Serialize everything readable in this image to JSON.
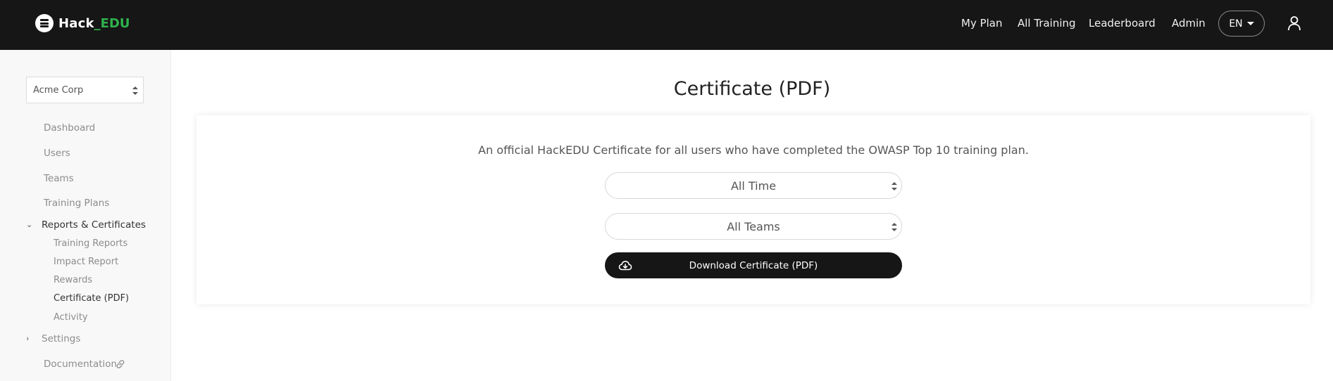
{
  "brand": {
    "name": "Hack",
    "accent": "_EDU",
    "accent_color": "#2fb24c",
    "icon": "hamburger-logo-icon"
  },
  "topnav": {
    "links": [
      {
        "label": "My Plan"
      },
      {
        "label": "All Training"
      },
      {
        "label": "Leaderboard"
      },
      {
        "label": "Admin"
      }
    ],
    "language": "EN",
    "user_icon": "user-icon",
    "background": "#161616"
  },
  "sidebar": {
    "org_select": {
      "value": "Acme Corp"
    },
    "items": [
      {
        "label": "Dashboard"
      },
      {
        "label": "Users"
      },
      {
        "label": "Teams"
      },
      {
        "label": "Training Plans"
      }
    ],
    "reports_group": {
      "label": "Reports & Certificates",
      "expanded": true,
      "children": [
        {
          "label": "Training Reports"
        },
        {
          "label": "Impact Report"
        },
        {
          "label": "Rewards"
        },
        {
          "label": "Certificate (PDF)",
          "active": true
        },
        {
          "label": "Activity"
        }
      ]
    },
    "settings_group": {
      "label": "Settings",
      "expanded": false
    },
    "documentation": {
      "label": "Documentation",
      "icon": "external-link-icon"
    }
  },
  "main": {
    "title": "Certificate (PDF)",
    "description": "An official HackEDU Certificate for all users who have completed the OWASP Top 10 training plan.",
    "time_select": {
      "value": "All Time"
    },
    "team_select": {
      "value": "All Teams"
    },
    "download_button": {
      "label": "Download Certificate (PDF)",
      "icon": "cloud-download-icon"
    }
  }
}
